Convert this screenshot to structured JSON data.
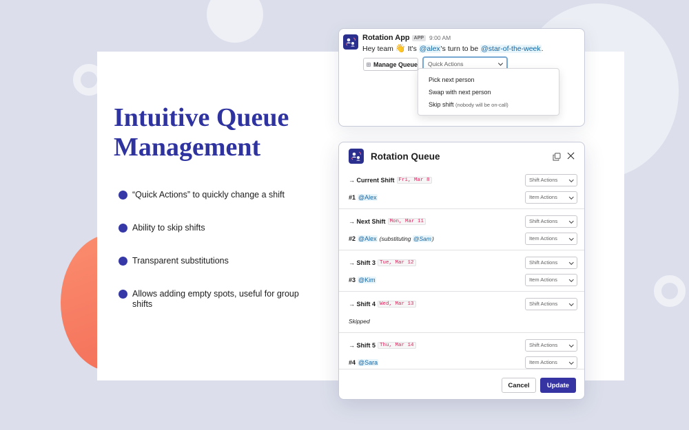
{
  "colors": {
    "accent": "#2f33a0",
    "bullet": "#3638a8",
    "update_button": "#3634a3",
    "mention": "#1264a3",
    "date_tag": "#e01e5a",
    "coral": "#f36e58"
  },
  "hero": {
    "headline": "Intuitive Queue Management",
    "features": [
      "“Quick Actions” to quickly change a shift",
      "Ability to skip shifts",
      "Transparent substitutions",
      "Allows adding empty spots, useful for group shifts"
    ]
  },
  "message": {
    "app_name": "Rotation App",
    "badge": "APP",
    "time": "9:00 AM",
    "text_before": "Hey team ",
    "emoji": "👋",
    "text_mid": " It's ",
    "mention_user": "@alex",
    "text_after": "'s turn to be ",
    "mention_group": "@star-of-the-week",
    "text_end": ".",
    "manage_queue_label": "Manage Queue",
    "quick_actions_placeholder": "Quick Actions",
    "dropdown_items": [
      {
        "label": "Pick next person",
        "note": ""
      },
      {
        "label": "Swap with next person",
        "note": ""
      },
      {
        "label": "Skip shift",
        "note": "(nobody will be on-call)"
      }
    ]
  },
  "modal": {
    "title": "Rotation Queue",
    "shift_actions_label": "Shift Actions",
    "item_actions_label": "Item Actions",
    "shifts": [
      {
        "label": "→ Current Shift",
        "date": "Fri, Mar 8",
        "num": "#1",
        "person": "@Alex"
      },
      {
        "label": "→ Next Shift",
        "date": "Mon, Mar 11",
        "num": "#2",
        "person": "@Alex",
        "subst_before": "(substituting ",
        "subst_person": "@Sam",
        "subst_after": ")"
      },
      {
        "label": "→ Shift 3",
        "date": "Tue, Mar 12",
        "num": "#3",
        "person": "@Kim"
      },
      {
        "label": "→ Shift 4",
        "date": "Wed, Mar 13",
        "skipped": "Skipped"
      },
      {
        "label": "→ Shift 5",
        "date": "Thu, Mar 14",
        "num": "#4",
        "person": "@Sara"
      }
    ],
    "cancel_label": "Cancel",
    "update_label": "Update"
  }
}
